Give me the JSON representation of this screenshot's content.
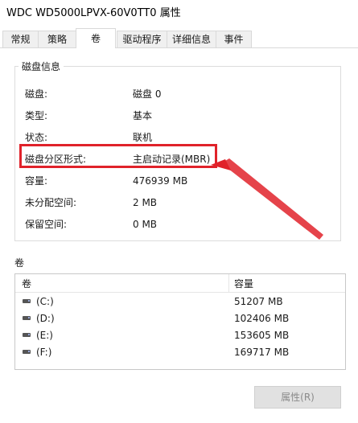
{
  "window": {
    "title": "WDC WD5000LPVX-60V0TT0 属性"
  },
  "tabs": [
    {
      "label": "常规"
    },
    {
      "label": "策略"
    },
    {
      "label": "卷"
    },
    {
      "label": "驱动程序"
    },
    {
      "label": "详细信息"
    },
    {
      "label": "事件"
    }
  ],
  "active_tab": "卷",
  "disk_info": {
    "group_title": "磁盘信息",
    "rows": [
      {
        "label": "磁盘:",
        "value": "磁盘 0"
      },
      {
        "label": "类型:",
        "value": "基本"
      },
      {
        "label": "状态:",
        "value": "联机"
      },
      {
        "label": "磁盘分区形式:",
        "value": "主启动记录(MBR)"
      },
      {
        "label": "容量:",
        "value": "476939 MB"
      },
      {
        "label": "未分配空间:",
        "value": "2 MB"
      },
      {
        "label": "保留空间:",
        "value": "0 MB"
      }
    ]
  },
  "volumes": {
    "section_label": "卷",
    "headers": {
      "volume": "卷",
      "capacity": "容量"
    },
    "items": [
      {
        "name": "(C:)",
        "capacity": "51207 MB"
      },
      {
        "name": "(D:)",
        "capacity": "102406 MB"
      },
      {
        "name": "(E:)",
        "capacity": "153605 MB"
      },
      {
        "name": "(F:)",
        "capacity": "169717 MB"
      }
    ]
  },
  "buttons": {
    "properties": "属性(R)"
  },
  "colors": {
    "highlight": "#e0222a",
    "disabled_text": "#8a8a8a"
  }
}
